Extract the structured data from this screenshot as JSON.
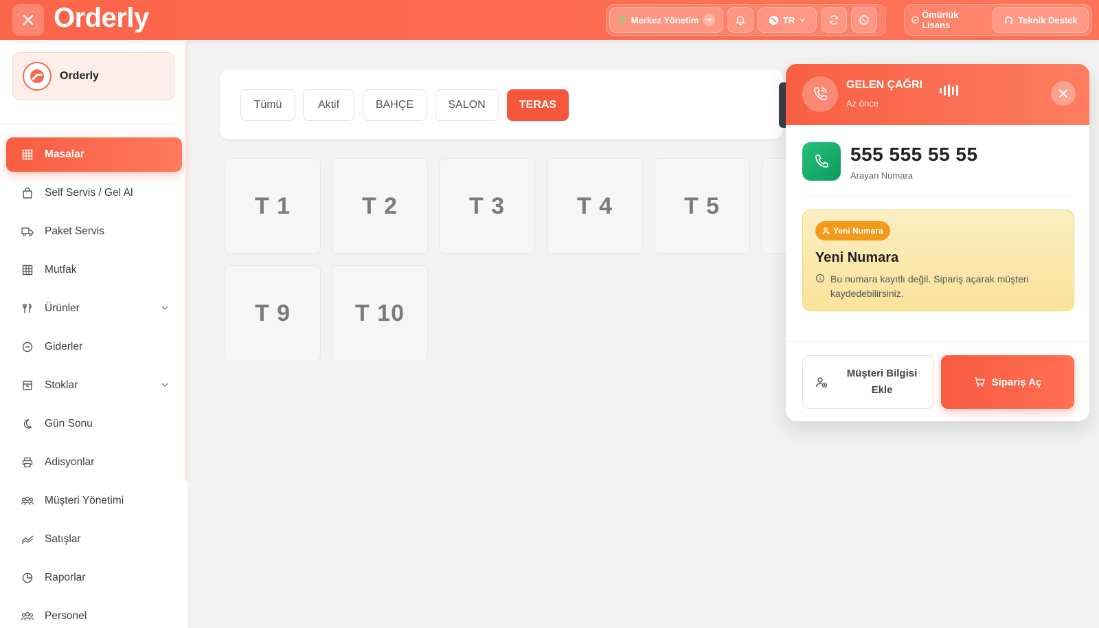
{
  "topbar": {
    "brand": "Orderly",
    "merkez_label": "Merkez Yönetim",
    "lang_label": "TR",
    "license_label": "Ömürlük Lisans",
    "support_label": "Teknik Destek"
  },
  "sidebar": {
    "brand_label": "Orderly",
    "items": [
      {
        "label": "Masalar",
        "icon": "grid-icon",
        "active": true
      },
      {
        "label": "Self Servis / Gel Al",
        "icon": "shopping-bag-icon"
      },
      {
        "label": "Paket Servis",
        "icon": "truck-icon"
      },
      {
        "label": "Mutfak",
        "icon": "grid-icon"
      },
      {
        "label": "Ürünler",
        "icon": "utensils-icon",
        "expandable": true
      },
      {
        "label": "Giderler",
        "icon": "minus-circle-icon"
      },
      {
        "label": "Stoklar",
        "icon": "archive-icon",
        "expandable": true
      },
      {
        "label": "Gün Sonu",
        "icon": "moon-icon"
      },
      {
        "label": "Adisyonlar",
        "icon": "printer-icon"
      },
      {
        "label": "Müşteri Yönetimi",
        "icon": "users-icon"
      },
      {
        "label": "Satışlar",
        "icon": "trend-icon"
      },
      {
        "label": "Raporlar",
        "icon": "pie-chart-icon"
      },
      {
        "label": "Personel",
        "icon": "users-icon"
      }
    ]
  },
  "filters": [
    "Tümü",
    "Aktif",
    "BAHÇE",
    "SALON",
    "TERAS"
  ],
  "active_filter": "TERAS",
  "tables": [
    "T 1",
    "T 2",
    "T 3",
    "T 4",
    "T 5",
    "T 9",
    "T 10"
  ],
  "call": {
    "title": "GELEN ÇAĞRI",
    "time": "Az önce",
    "number": "555 555 55 55",
    "number_caption": "Arayan Numara",
    "badge": "Yeni Numara",
    "card_title": "Yeni Numara",
    "card_desc": "Bu numara kayıtlı değil. Sipariş açarak müşteri kaydedebilirsiniz.",
    "add_customer_label": "Müşteri Bilgisi Ekle",
    "open_order_label": "Sipariş Aç"
  },
  "colors": {
    "accent": "#f6573c",
    "call_green": "#17a866",
    "badge_orange": "#f39a1b"
  }
}
